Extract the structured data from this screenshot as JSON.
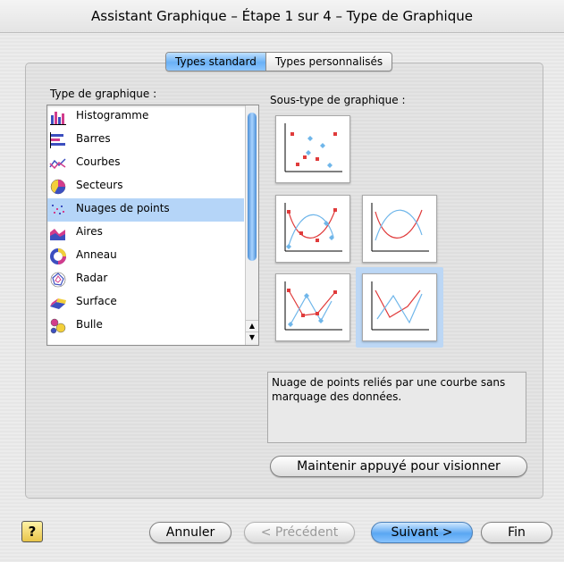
{
  "window": {
    "title": "Assistant Graphique – Étape 1 sur 4 – Type de Graphique"
  },
  "tabs": [
    {
      "label": "Types standard",
      "active": true
    },
    {
      "label": "Types personnalisés",
      "active": false
    }
  ],
  "chart_types": {
    "label": "Type de graphique :",
    "selected": "Nuages de points",
    "items": [
      {
        "label": "Histogramme",
        "icon": "histogram-icon"
      },
      {
        "label": "Barres",
        "icon": "bar-icon"
      },
      {
        "label": "Courbes",
        "icon": "line-icon"
      },
      {
        "label": "Secteurs",
        "icon": "pie-icon"
      },
      {
        "label": "Nuages de points",
        "icon": "scatter-icon"
      },
      {
        "label": "Aires",
        "icon": "area-icon"
      },
      {
        "label": "Anneau",
        "icon": "doughnut-icon"
      },
      {
        "label": "Radar",
        "icon": "radar-icon"
      },
      {
        "label": "Surface",
        "icon": "surface-icon"
      },
      {
        "label": "Bulle",
        "icon": "bubble-icon"
      }
    ]
  },
  "subtypes": {
    "label": "Sous-type de graphique :",
    "description": "Nuage de points reliés par une courbe sans marquage des données.",
    "options": [
      {
        "name": "scatter-markers-only"
      },
      {
        "name": "scatter-smooth-markers"
      },
      {
        "name": "scatter-smooth-no-markers"
      },
      {
        "name": "scatter-lines-markers"
      },
      {
        "name": "scatter-lines-no-markers"
      }
    ],
    "selected": "scatter-lines-no-markers"
  },
  "preview_button": {
    "label": "Maintenir appuyé pour visionner"
  },
  "footer": {
    "help": "?",
    "cancel": "Annuler",
    "previous": "< Précédent",
    "next": "Suivant >",
    "finish": "Fin"
  },
  "colors": {
    "accent": "#6ab1f5",
    "selection": "#b5d5f8",
    "series_red": "#e03b3b",
    "series_blue": "#6fb6ea"
  }
}
